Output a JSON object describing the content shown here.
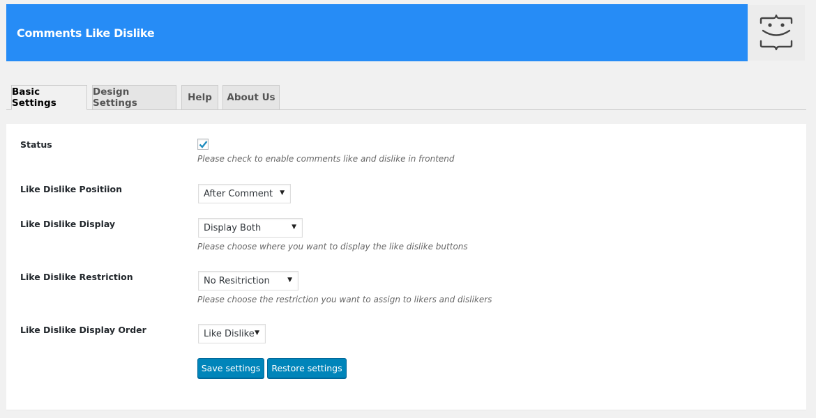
{
  "header": {
    "title": "Comments Like Dislike",
    "logo_icon": "smiley-braces-logo-icon",
    "color": "#268cf6"
  },
  "tabs": [
    {
      "label": "Basic Settings",
      "active": true
    },
    {
      "label": "Design Settings",
      "active": false
    },
    {
      "label": "Help",
      "active": false
    },
    {
      "label": "About Us",
      "active": false
    }
  ],
  "settings": {
    "status": {
      "label": "Status",
      "checked": true,
      "description": "Please check to enable comments like and dislike in frontend"
    },
    "position": {
      "label": "Like Dislike Positiion",
      "value": "After Comment"
    },
    "display": {
      "label": "Like Dislike Display",
      "value": "Display Both",
      "description": "Please choose where you want to display the like dislike buttons"
    },
    "restriction": {
      "label": "Like Dislike Restriction",
      "value": "No Resitriction",
      "description": "Please choose the restriction you want to assign to likers and dislikers"
    },
    "order": {
      "label": "Like Dislike Display Order",
      "value": "Like Dislike"
    }
  },
  "buttons": {
    "save": "Save settings",
    "restore": "Restore settings",
    "color": "#0085ba"
  }
}
